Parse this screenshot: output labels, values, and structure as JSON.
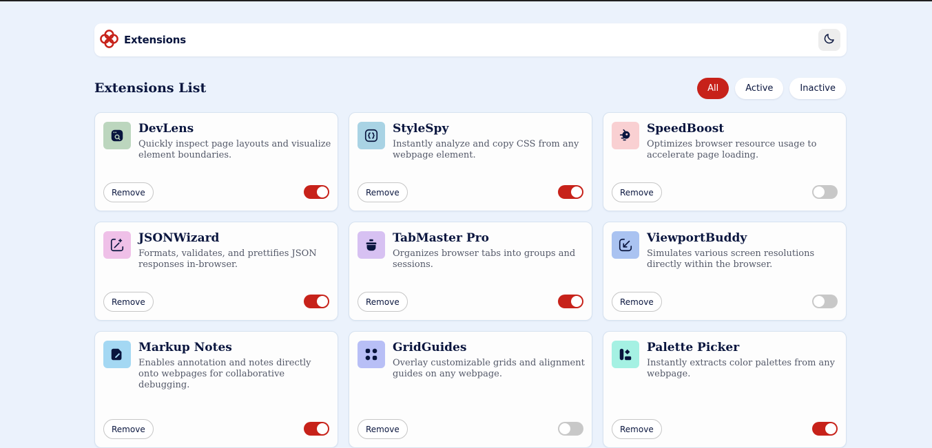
{
  "header": {
    "brand": "Extensions",
    "theme_icon": "moon-icon",
    "logo_color": "#c7221a"
  },
  "list_title": "Extensions List",
  "filters": [
    {
      "label": "All",
      "active": true
    },
    {
      "label": "Active",
      "active": false
    },
    {
      "label": "Inactive",
      "active": false
    }
  ],
  "remove_label": "Remove",
  "colors": {
    "accent": "#c7221a",
    "toggle_off": "#c8c8c8",
    "background": "#ebf2fc"
  },
  "extensions": [
    {
      "name": "DevLens",
      "description": "Quickly inspect page layouts and visualize element boundaries.",
      "icon": "browser-search-icon",
      "icon_bg": "#bcd6be",
      "active": true
    },
    {
      "name": "StyleSpy",
      "description": "Instantly analyze and copy CSS from any webpage element.",
      "icon": "code-braces-icon",
      "icon_bg": "#a9d3e4",
      "active": true
    },
    {
      "name": "SpeedBoost",
      "description": "Optimizes browser resource usage to accelerate page loading.",
      "icon": "rocket-icon",
      "icon_bg": "#f9d0d2",
      "active": false
    },
    {
      "name": "JSONWizard",
      "description": "Formats, validates, and prettifies JSON responses in-browser.",
      "icon": "magic-wand-icon",
      "icon_bg": "#efc0e8",
      "active": true
    },
    {
      "name": "TabMaster Pro",
      "description": "Organizes browser tabs into groups and sessions.",
      "icon": "tabs-icon",
      "icon_bg": "#d7c1f2",
      "active": true
    },
    {
      "name": "ViewportBuddy",
      "description": "Simulates various screen resolutions directly within the browser.",
      "icon": "viewport-icon",
      "icon_bg": "#aac3f1",
      "active": false
    },
    {
      "name": "Markup Notes",
      "description": "Enables annotation and notes directly onto webpages for collaborative debugging.",
      "icon": "note-pen-icon",
      "icon_bg": "#a4d8f3",
      "active": true
    },
    {
      "name": "GridGuides",
      "description": "Overlay customizable grids and alignment guides on any webpage.",
      "icon": "grid-icon",
      "icon_bg": "#b8bff6",
      "active": false
    },
    {
      "name": "Palette Picker",
      "description": "Instantly extracts color palettes from any webpage.",
      "icon": "palette-icon",
      "icon_bg": "#a5f1e3",
      "active": true
    }
  ]
}
